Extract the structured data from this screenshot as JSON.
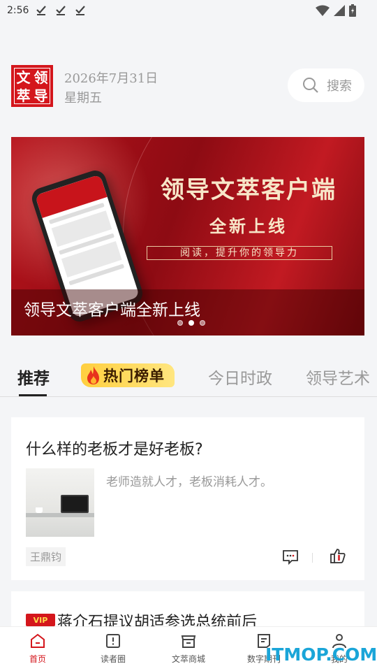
{
  "status_bar": {
    "time": "2:56",
    "notification_icons": [
      "download-done-icon",
      "download-done-icon",
      "download-done-icon"
    ],
    "right_icons": [
      "wifi-icon",
      "signal-icon",
      "battery-icon"
    ]
  },
  "header": {
    "logo_chars": [
      "文",
      "领",
      "萃",
      "导"
    ],
    "date": "2026年7月31日",
    "weekday": "星期五",
    "search_label": "搜索"
  },
  "banner": {
    "title": "领导文萃客户端",
    "subtitle": "全新上线",
    "slogan": "阅读，提升你的领导力",
    "caption": "领导文萃客户端全新上线",
    "slide_count": 3,
    "active_slide": 2
  },
  "tabs": {
    "items": [
      {
        "label": "推荐",
        "active": true
      },
      {
        "label": "热门榜单",
        "active": false
      },
      {
        "label": "今日时政",
        "active": false
      },
      {
        "label": "领导艺术",
        "active": false
      }
    ]
  },
  "articles": [
    {
      "title": "什么样的老板才是好老板?",
      "excerpt": "老师造就人才，老板消耗人才。",
      "author": "王鼎钧"
    },
    {
      "badge": "VIP",
      "title": "蒋介石提议胡适参选总统前后"
    }
  ],
  "bottom_nav": {
    "items": [
      {
        "label": "首页",
        "icon": "home-icon",
        "active": true
      },
      {
        "label": "读者圈",
        "icon": "book-icon",
        "active": false
      },
      {
        "label": "文萃商城",
        "icon": "store-icon",
        "active": false
      },
      {
        "label": "数字期刊",
        "icon": "journal-icon",
        "active": false
      },
      {
        "label": "我的",
        "icon": "profile-icon",
        "active": false
      }
    ]
  },
  "watermark": "ITMOP.COM",
  "colors": {
    "brand_red": "#d4161c",
    "hot_tab_yellow": "#ffcf3f",
    "watermark_blue": "#1aa5d8"
  }
}
